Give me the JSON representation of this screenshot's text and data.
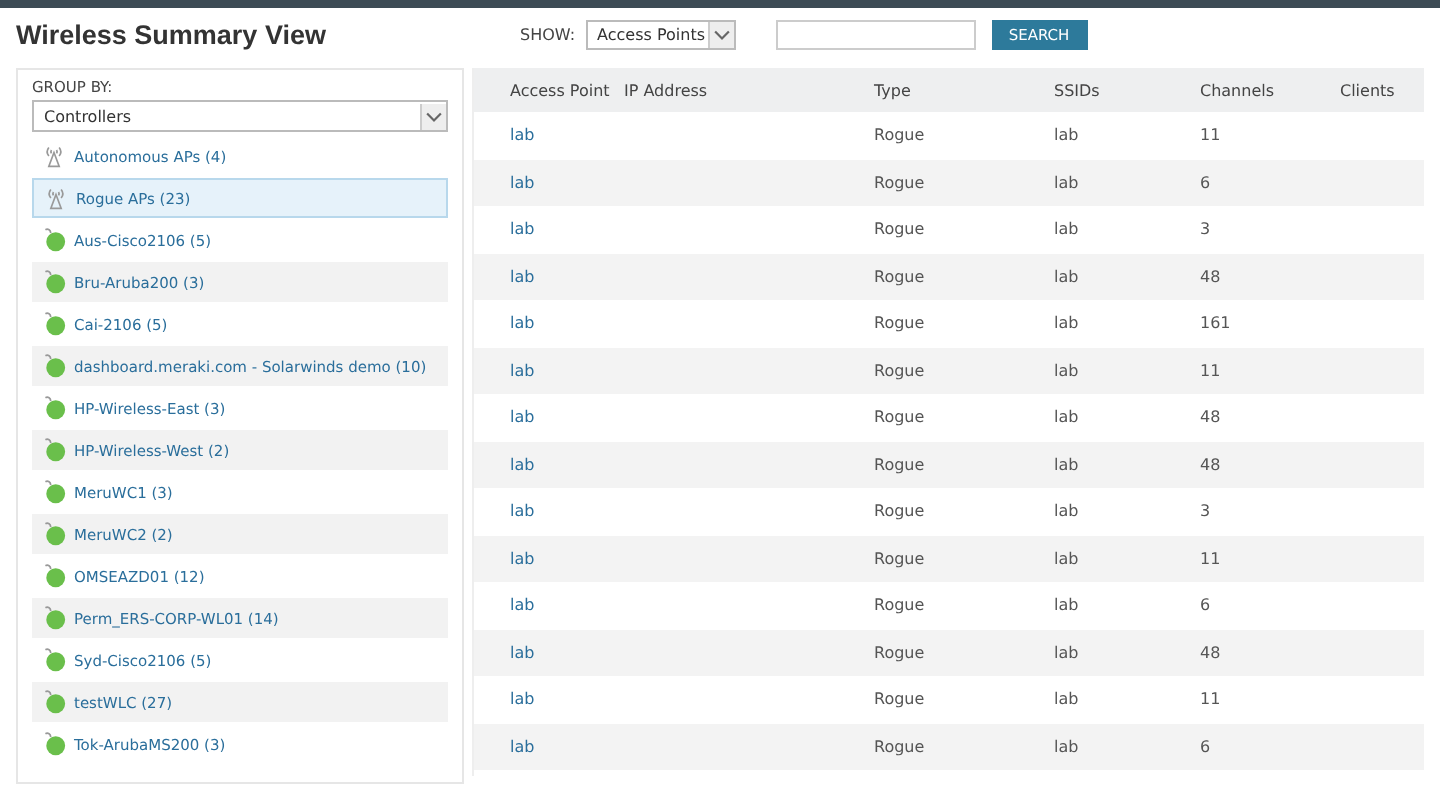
{
  "title": "Wireless Summary View",
  "show": {
    "label": "SHOW:",
    "value": "Access Points"
  },
  "search": {
    "button": "SEARCH"
  },
  "group_by": {
    "label": "GROUP BY:",
    "value": "Controllers"
  },
  "sidebar": {
    "items": [
      {
        "label": "Autonomous APs (4)",
        "kind": "antenna",
        "selected": false
      },
      {
        "label": "Rogue APs (23)",
        "kind": "antenna",
        "selected": true
      },
      {
        "label": "Aus-Cisco2106 (5)",
        "kind": "controller",
        "selected": false
      },
      {
        "label": "Bru-Aruba200 (3)",
        "kind": "controller",
        "selected": false
      },
      {
        "label": "Cai-2106 (5)",
        "kind": "controller",
        "selected": false
      },
      {
        "label": "dashboard.meraki.com - Solarwinds demo (10)",
        "kind": "controller",
        "selected": false
      },
      {
        "label": "HP-Wireless-East (3)",
        "kind": "controller",
        "selected": false
      },
      {
        "label": "HP-Wireless-West (2)",
        "kind": "controller",
        "selected": false
      },
      {
        "label": "MeruWC1 (3)",
        "kind": "controller",
        "selected": false
      },
      {
        "label": "MeruWC2 (2)",
        "kind": "controller",
        "selected": false
      },
      {
        "label": "OMSEAZD01 (12)",
        "kind": "controller",
        "selected": false
      },
      {
        "label": "Perm_ERS-CORP-WL01 (14)",
        "kind": "controller",
        "selected": false
      },
      {
        "label": "Syd-Cisco2106 (5)",
        "kind": "controller",
        "selected": false
      },
      {
        "label": "testWLC (27)",
        "kind": "controller",
        "selected": false
      },
      {
        "label": "Tok-ArubaMS200 (3)",
        "kind": "controller",
        "selected": false
      }
    ]
  },
  "table": {
    "columns": [
      "Access Point",
      "IP Address",
      "Type",
      "SSIDs",
      "Channels",
      "Clients"
    ],
    "rows": [
      [
        "lab",
        "",
        "Rogue",
        "lab",
        "11",
        ""
      ],
      [
        "lab",
        "",
        "Rogue",
        "lab",
        "6",
        ""
      ],
      [
        "lab",
        "",
        "Rogue",
        "lab",
        "3",
        ""
      ],
      [
        "lab",
        "",
        "Rogue",
        "lab",
        "48",
        ""
      ],
      [
        "lab",
        "",
        "Rogue",
        "lab",
        "161",
        ""
      ],
      [
        "lab",
        "",
        "Rogue",
        "lab",
        "11",
        ""
      ],
      [
        "lab",
        "",
        "Rogue",
        "lab",
        "48",
        ""
      ],
      [
        "lab",
        "",
        "Rogue",
        "lab",
        "48",
        ""
      ],
      [
        "lab",
        "",
        "Rogue",
        "lab",
        "3",
        ""
      ],
      [
        "lab",
        "",
        "Rogue",
        "lab",
        "11",
        ""
      ],
      [
        "lab",
        "",
        "Rogue",
        "lab",
        "6",
        ""
      ],
      [
        "lab",
        "",
        "Rogue",
        "lab",
        "48",
        ""
      ],
      [
        "lab",
        "",
        "Rogue",
        "lab",
        "11",
        ""
      ],
      [
        "lab",
        "",
        "Rogue",
        "lab",
        "6",
        ""
      ]
    ]
  }
}
